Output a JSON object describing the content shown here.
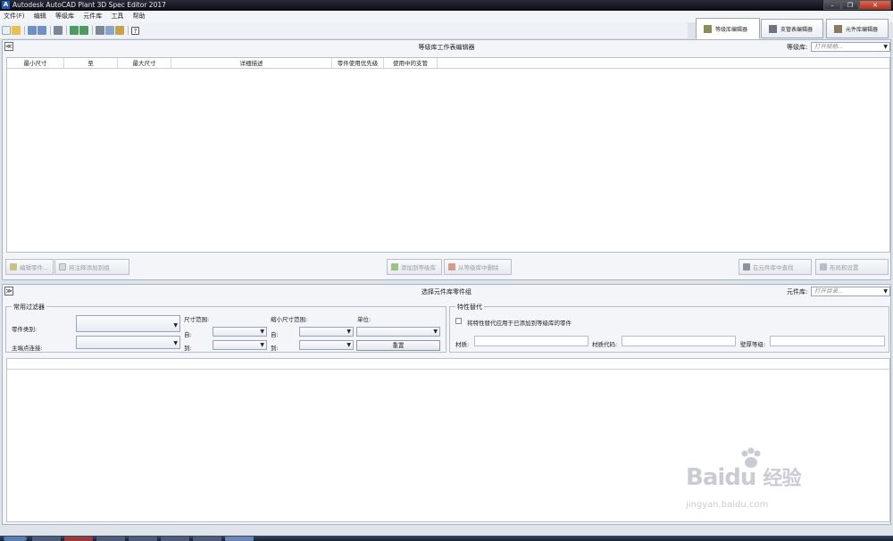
{
  "window": {
    "title": "Autodesk AutoCAD Plant 3D Spec Editor 2017",
    "min": "–",
    "max": "❐",
    "close": "✕"
  },
  "menu": [
    "文件(F)",
    "编辑",
    "等级库",
    "元件库",
    "工具",
    "帮助"
  ],
  "editor_tabs": [
    {
      "label": "等级库编辑器",
      "active": true
    },
    {
      "label": "支管表编辑器",
      "active": false
    },
    {
      "label": "元件库编辑器",
      "active": false
    }
  ],
  "spec_panel": {
    "title": "等级库工作表编辑器",
    "collapse": "≪",
    "spec_label": "等级库:",
    "spec_placeholder": "打开规格...",
    "columns": [
      "最小尺寸",
      "至",
      "最大尺寸",
      "详细描述",
      "零件使用优先级",
      "使用中的支管"
    ],
    "buttons": {
      "edit_part": "编辑零件...",
      "add_note": "将注释添加到组",
      "add_to_spec": "添加到等级库",
      "remove_from_spec": "从等级库中删除",
      "find_in_catalog": "在元件库中查找",
      "layout_settings": "布局和设置"
    }
  },
  "catalog_panel": {
    "title": "选择元件库零件组",
    "collapse": "≫",
    "catalog_label": "元件库:",
    "catalog_placeholder": "打开目录...",
    "filters": {
      "title": "常用过滤器",
      "part_category": "零件类别:",
      "main_end_connection": "主端点连接:",
      "size_range": "尺寸范围:",
      "from": "自:",
      "to": "到:",
      "reducing_size_range": "缩小尺寸范围:",
      "units": "单位:",
      "reset": "重置"
    },
    "overrides": {
      "title": "特性替代",
      "apply_label": "将特性替代应用于已添加到等级库的零件",
      "material": "材质:",
      "material_code": "材质代码:",
      "wall_thickness": "壁厚等级:"
    }
  },
  "watermark": {
    "logo": "Bai",
    "logo2": "du",
    "logo_cn": "经验",
    "url": "jingyan.baidu.com"
  },
  "colors": {
    "accent": "#1c5fb8",
    "panel_bg": "#f3f5f9",
    "border": "#a9b3c3"
  }
}
